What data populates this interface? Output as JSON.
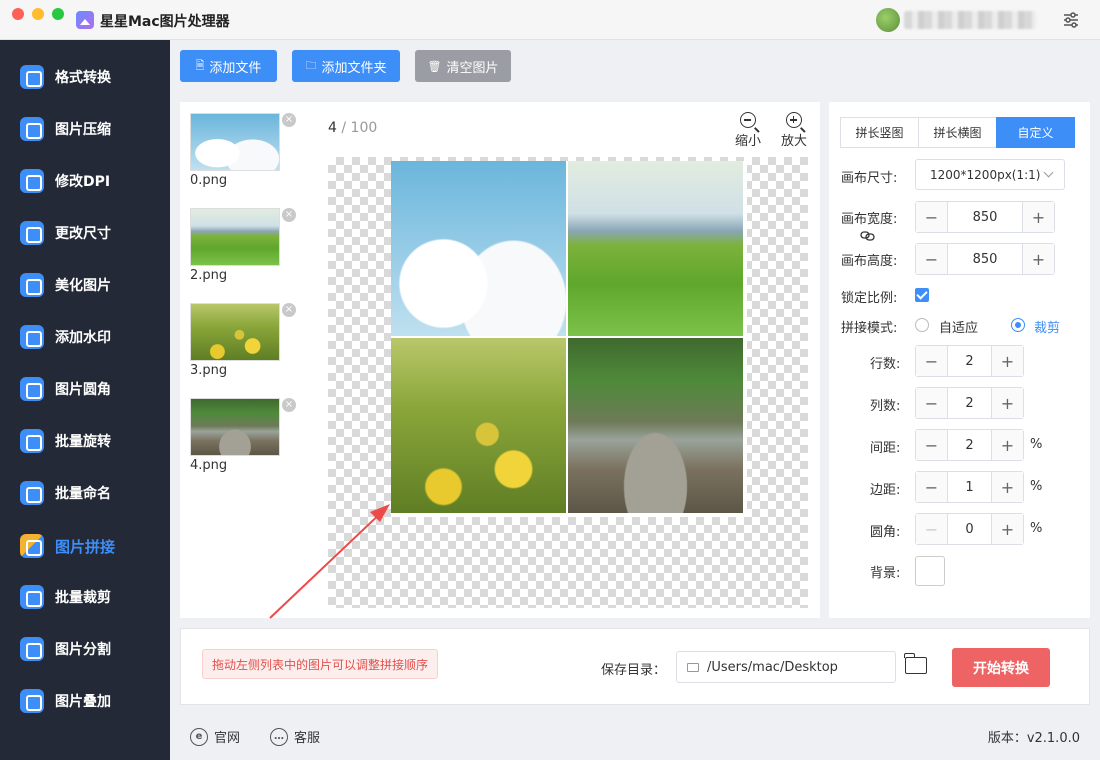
{
  "app": {
    "title": "星星Mac图片处理器"
  },
  "sidebar": {
    "items": [
      {
        "label": "格式转换",
        "icon": "format-convert-icon"
      },
      {
        "label": "图片压缩",
        "icon": "compress-icon"
      },
      {
        "label": "修改DPI",
        "icon": "dpi-icon"
      },
      {
        "label": "更改尺寸",
        "icon": "resize-icon"
      },
      {
        "label": "美化图片",
        "icon": "beautify-icon"
      },
      {
        "label": "添加水印",
        "icon": "watermark-icon"
      },
      {
        "label": "图片圆角",
        "icon": "rounded-corner-icon"
      },
      {
        "label": "批量旋转",
        "icon": "rotate-icon"
      },
      {
        "label": "批量命名",
        "icon": "rename-icon"
      },
      {
        "label": "图片拼接",
        "icon": "stitch-icon",
        "active": true
      },
      {
        "label": "批量裁剪",
        "icon": "crop-icon"
      },
      {
        "label": "图片分割",
        "icon": "split-icon"
      },
      {
        "label": "图片叠加",
        "icon": "overlay-icon"
      }
    ]
  },
  "toolbar": {
    "add_file": "添加文件",
    "add_folder": "添加文件夹",
    "clear_images": "清空图片"
  },
  "file_list": [
    {
      "name": "0.png"
    },
    {
      "name": "2.png"
    },
    {
      "name": "3.png"
    },
    {
      "name": "4.png"
    }
  ],
  "preview": {
    "current": "4",
    "separator": "/",
    "total": "100",
    "zoom_out": "缩小",
    "zoom_in": "放大"
  },
  "settings": {
    "tabs": [
      "拼长竖图",
      "拼长横图",
      "自定义"
    ],
    "active_tab": "自定义",
    "canvas_size_label": "画布尺寸:",
    "canvas_size_value": "1200*1200px(1:1)",
    "canvas_width_label": "画布宽度:",
    "canvas_width": "850",
    "canvas_height_label": "画布高度:",
    "canvas_height": "850",
    "lock_ratio_label": "锁定比例:",
    "lock_ratio": true,
    "mode_label": "拼接模式:",
    "mode_fit": "自适应",
    "mode_crop": "裁剪",
    "mode_selected": "裁剪",
    "rows_label": "行数:",
    "rows": "2",
    "cols_label": "列数:",
    "cols": "2",
    "spacing_label": "间距:",
    "spacing": "2",
    "margin_label": "边距:",
    "margin": "1",
    "radius_label": "圆角:",
    "radius": "0",
    "percent": "%",
    "background_label": "背景:",
    "background_color": "#ffffff"
  },
  "bottom": {
    "hint": "拖动左侧列表中的图片可以调整拼接顺序",
    "save_label": "保存目录：",
    "save_path": "/Users/mac/Desktop",
    "start_button": "开始转换"
  },
  "footer": {
    "website": "官网",
    "support": "客服",
    "version": "版本：v2.1.0.0"
  },
  "colors": {
    "accent": "#3e8ef7",
    "start_button": "#ee6464",
    "sidebar_bg": "#232936"
  }
}
